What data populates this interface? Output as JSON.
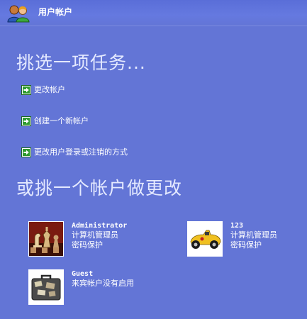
{
  "window": {
    "title": "用户帐户",
    "icon": "users-icon"
  },
  "tasks": {
    "heading": "挑选一项任务...",
    "items": [
      {
        "label": "更改帐户",
        "icon": "green-arrow-icon"
      },
      {
        "label": "创建一个新帐户",
        "icon": "green-arrow-icon"
      },
      {
        "label": "更改用户登录或注销的方式",
        "icon": "green-arrow-icon"
      }
    ]
  },
  "accounts": {
    "heading": "或挑一个帐户做更改",
    "items": [
      {
        "name": "Administrator",
        "type": "计算机管理员",
        "status": "密码保护",
        "avatar": "chess-pieces-avatar"
      },
      {
        "name": "123",
        "type": "计算机管理员",
        "status": "密码保护",
        "avatar": "race-car-avatar"
      },
      {
        "name": "Guest",
        "type": "来宾帐户没有启用",
        "status": "",
        "avatar": "suitcase-avatar"
      }
    ]
  },
  "colors": {
    "background": "#6375d6",
    "heading": "#e4e9ff",
    "arrow_green": "#2f9a2f"
  }
}
